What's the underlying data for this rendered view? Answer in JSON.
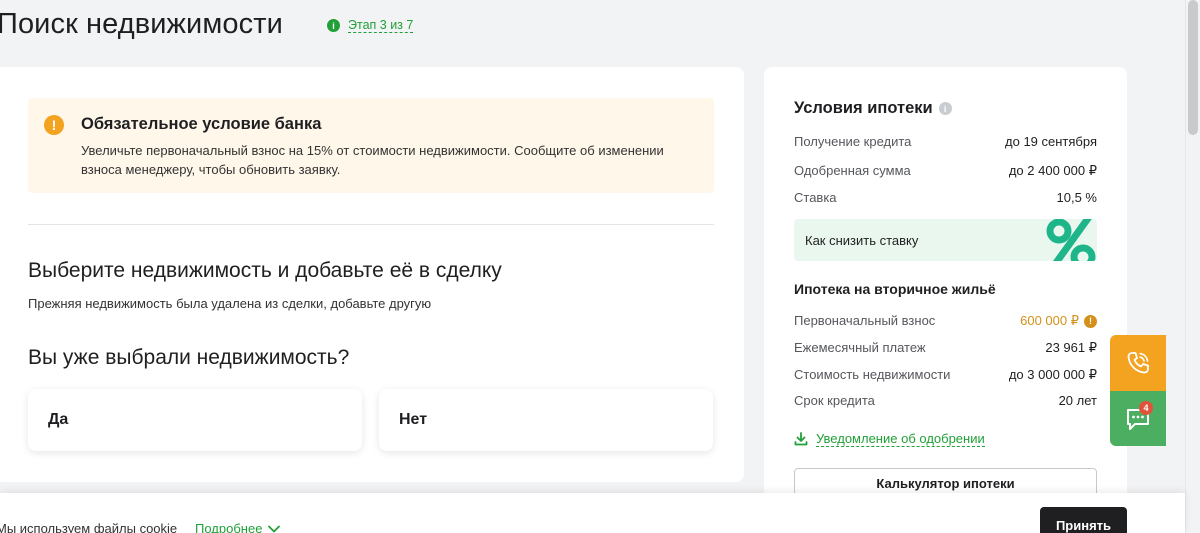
{
  "header": {
    "title": "Поиск недвижимости",
    "stage": "Этап 3 из 7"
  },
  "alert": {
    "title": "Обязательное условие банка",
    "text": "Увеличьте первоначальный взнос на 15% от стоимости недвижимости. Сообщите об изменении взноса менеджеру, чтобы обновить заявку."
  },
  "main": {
    "section_title": "Выберите недвижимость и добавьте её в сделку",
    "section_subtitle": "Прежняя недвижимость была удалена из сделки, добавьте другую",
    "question": "Вы уже выбрали недвижимость?",
    "choices": [
      "Да",
      "Нет"
    ]
  },
  "mortgage": {
    "title": "Условия ипотеки",
    "rows": [
      {
        "label": "Получение кредита",
        "value": "до 19 сентября"
      },
      {
        "label": "Одобренная сумма",
        "value": "до 2 400 000 ₽"
      },
      {
        "label": "Ставка",
        "value": "10,5 %"
      }
    ],
    "rate_banner": "Как снизить ставку",
    "subtitle": "Ипотека на вторичное жильё",
    "details": [
      {
        "label": "Первоначальный взнос",
        "value": "600 000 ₽"
      },
      {
        "label": "Ежемесячный платеж",
        "value": "23 961 ₽"
      },
      {
        "label": "Стоимость недвижимости",
        "value": "до 3 000 000 ₽"
      },
      {
        "label": "Срок кредита",
        "value": "20 лет"
      }
    ],
    "notify_link": "Уведомление об одобрении",
    "calc_button": "Калькулятор ипотеки"
  },
  "floating": {
    "chat_badge": "4"
  },
  "cookie": {
    "text": "Мы используем файлы cookie",
    "more": "Подробнее",
    "accept": "Принять"
  },
  "colors": {
    "accent_green": "#21a038",
    "warning_orange": "#f3a320",
    "dark": "#1f1f22"
  }
}
